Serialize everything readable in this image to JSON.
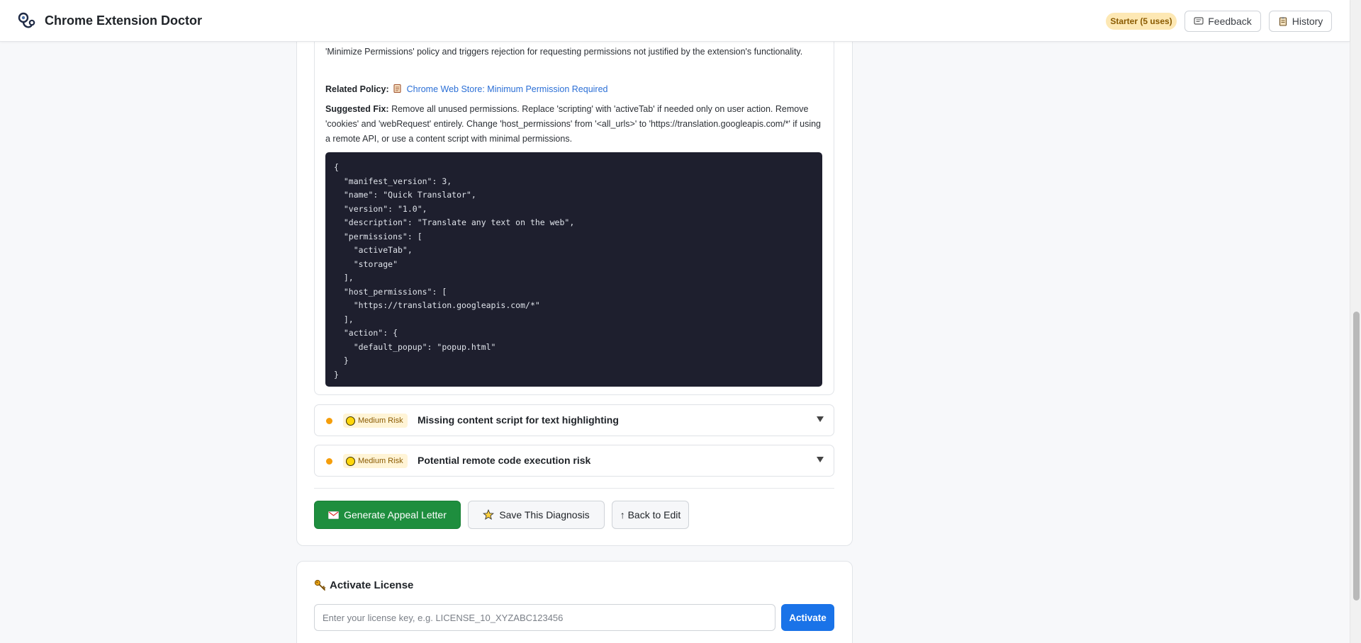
{
  "header": {
    "app_title": "Chrome Extension Doctor",
    "plan_badge": "Starter (5 uses)",
    "feedback_label": "Feedback",
    "history_label": "History"
  },
  "issue": {
    "description": "'Minimize Permissions' policy and triggers rejection for requesting permissions not justified by the extension's functionality.",
    "related_policy_label": "Related Policy:",
    "related_policy_link": "Chrome Web Store: Minimum Permission Required",
    "suggested_fix_label": "Suggested Fix:",
    "suggested_fix_text": "Remove all unused permissions. Replace 'scripting' with 'activeTab' if needed only on user action. Remove 'cookies' and 'webRequest' entirely. Change 'host_permissions' from '<all_urls>' to 'https://translation.googleapis.com/*' if using a remote API, or use a content script with minimal permissions.",
    "code": "{\n  \"manifest_version\": 3,\n  \"name\": \"Quick Translator\",\n  \"version\": \"1.0\",\n  \"description\": \"Translate any text on the web\",\n  \"permissions\": [\n    \"activeTab\",\n    \"storage\"\n  ],\n  \"host_permissions\": [\n    \"https://translation.googleapis.com/*\"\n  ],\n  \"action\": {\n    \"default_popup\": \"popup.html\"\n  }\n}"
  },
  "risks": [
    {
      "badge": "Medium Risk",
      "title": "Missing content script for text highlighting"
    },
    {
      "badge": "Medium Risk",
      "title": "Potential remote code execution risk"
    }
  ],
  "actions": {
    "appeal_label": "Generate Appeal Letter",
    "save_label": "Save This Diagnosis",
    "back_label": "↑ Back to Edit"
  },
  "license": {
    "title": "Activate License",
    "input_placeholder": "Enter your license key, e.g. LICENSE_10_XYZABC123456",
    "activate_label": "Activate"
  },
  "colors": {
    "accent_blue": "#1a73e8",
    "appeal_green": "#1e8e3e",
    "risk_orange": "#f59e0b",
    "code_bg": "#1e1f2e"
  }
}
